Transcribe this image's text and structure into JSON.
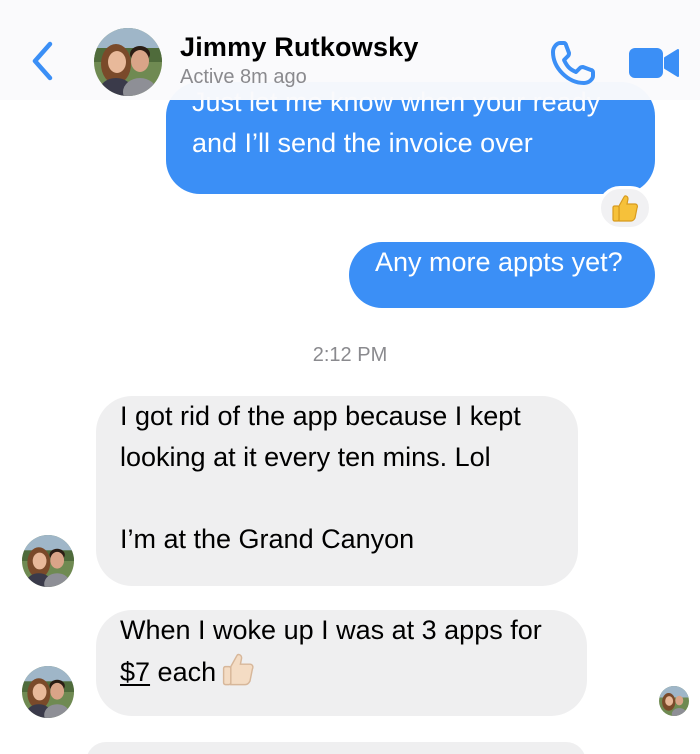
{
  "header": {
    "contact_name": "Jimmy Rutkowsky",
    "status": "Active 8m ago"
  },
  "messages": {
    "m1": {
      "line1": "Just let me know when your ready",
      "line2": "and I’ll send the invoice over",
      "reaction": "thumbs-up"
    },
    "m2": {
      "text": "Any more appts yet?"
    },
    "timestamp": "2:12 PM",
    "m3": {
      "line1": "I got rid of the app because I kept",
      "line2": "looking at it every ten mins. Lol",
      "line3": "I’m at the Grand Canyon"
    },
    "m4": {
      "line1": "When I woke up I was at 3 apps for",
      "price": "$7",
      "line2_rest": " each"
    }
  },
  "colors": {
    "accent": "#3b8ff6",
    "incoming_bubble": "#efeff0",
    "secondary_text": "#8a8a8e"
  },
  "icons": [
    "back-chevron-icon",
    "phone-icon",
    "video-camera-icon",
    "thumbs-up-icon"
  ]
}
